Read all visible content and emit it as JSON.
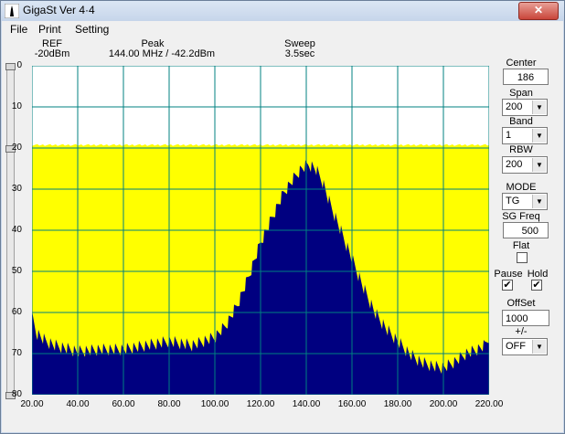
{
  "window": {
    "title": "GigaSt Ver 4·4",
    "close_label": "✕"
  },
  "menu": {
    "items": [
      "File",
      "Print",
      "Setting"
    ]
  },
  "header": {
    "ref_label": "REF",
    "ref_value": "-20dBm",
    "peak_label": "Peak",
    "peak_value": "144.00 MHz / -42.2dBm",
    "sweep_label": "Sweep",
    "sweep_value": "3.5sec"
  },
  "controls": {
    "center_label": "Center",
    "center_value": "186",
    "span_label": "Span",
    "span_value": "200",
    "band_label": "Band",
    "band_value": "1",
    "rbw_label": "RBW",
    "rbw_value": "200",
    "mode_label": "MODE",
    "mode_value": "TG",
    "sgfreq_label": "SG Freq",
    "sgfreq_value": "500",
    "flat_label": "Flat",
    "flat_checked": false,
    "pause_label": "Pause",
    "pause_checked": true,
    "hold_label": "Hold",
    "hold_checked": true,
    "offset_label": "OffSet",
    "offset_value": "1000",
    "plusminus_label": "+/-",
    "plusminus_value": "OFF"
  },
  "chart_data": {
    "type": "area",
    "x_tick_labels": [
      "20.00",
      "40.00",
      "60.00",
      "80.00",
      "100.00",
      "120.00",
      "140.00",
      "160.00",
      "180.00",
      "200.00",
      "220.00"
    ],
    "y_tick_labels": [
      "0",
      "10",
      "20",
      "30",
      "40",
      "50",
      "60",
      "70",
      "80"
    ],
    "xlim": [
      20,
      220
    ],
    "ylim": [
      0,
      80
    ],
    "grid": true,
    "colors": {
      "background": "#ffff00",
      "upper_band": "#ffffff",
      "trace": "#000080",
      "grid": "#008080"
    },
    "series": [
      {
        "values_x": [
          20,
          22,
          26,
          30,
          40,
          50,
          60,
          70,
          80,
          90,
          100,
          105,
          110,
          115,
          120,
          125,
          130,
          135,
          138,
          141,
          144,
          147,
          150,
          155,
          160,
          165,
          170,
          175,
          180,
          185,
          190,
          195,
          200,
          205,
          210,
          215,
          218,
          220
        ],
        "values_y": [
          61,
          65,
          67,
          68,
          69.5,
          69,
          69,
          68,
          67,
          68,
          66,
          63,
          58,
          51,
          43,
          37,
          31,
          27,
          25,
          24,
          25,
          28,
          33,
          40,
          47,
          54,
          60,
          64,
          67,
          70,
          72,
          73,
          73.5,
          72,
          70,
          69,
          68,
          66
        ]
      },
      {
        "values_x": [
          20,
          220
        ],
        "values_y": [
          19.5,
          19.5
        ]
      }
    ]
  }
}
